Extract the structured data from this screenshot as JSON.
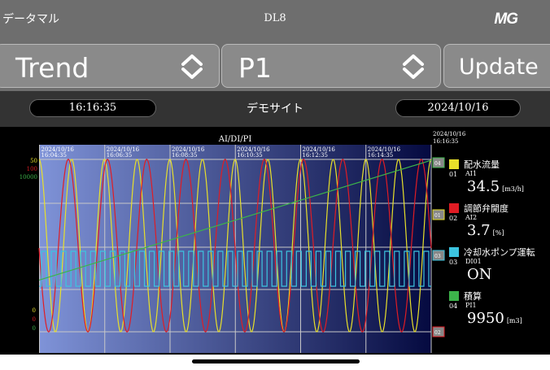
{
  "header": {
    "app_title": "データマル",
    "device_title": "DL8",
    "logo_text": "MG"
  },
  "controls": {
    "view_select": "Trend",
    "page_select": "P1",
    "update_label": "Update"
  },
  "info": {
    "time": "16:16:35",
    "site_name": "デモサイト",
    "date": "2024/10/16"
  },
  "colors": {
    "ai1": "#e8e02a",
    "ai2": "#e01c24",
    "di01": "#3cc4e0",
    "pi1": "#3cb44a",
    "plot_bg_left": "#7f93d8",
    "plot_bg_right": "#050a40"
  },
  "chart_data": {
    "type": "line",
    "title": "AI/DI/PI",
    "x_labels": [
      "2024/10/16 16:04:35",
      "2024/10/16 16:06:35",
      "2024/10/16 16:08:35",
      "2024/10/16 16:10:35",
      "2024/10/16 16:12:35",
      "2024/10/16 16:14:35"
    ],
    "x_end_label": "2024/10/16 16:16:35",
    "y_axis_top": [
      "50",
      "100",
      "10000"
    ],
    "y_axis_bottom": [
      "0",
      "0",
      "0"
    ],
    "grid": true,
    "series": [
      {
        "num": "01",
        "name": "配水流量",
        "tag": "AI1",
        "value": "34.5",
        "unit": "[m3/h]",
        "ylim": [
          0,
          50
        ],
        "kind": "sine",
        "amplitude": 25,
        "offset": 25,
        "period_min": 1.0,
        "phase": 0.0
      },
      {
        "num": "02",
        "name": "調節弁開度",
        "tag": "AI2",
        "value": "3.7",
        "unit": "[%]",
        "ylim": [
          0,
          100
        ],
        "kind": "sine",
        "amplitude": 50,
        "offset": 50,
        "period_min": 1.2,
        "phase": 1.6
      },
      {
        "num": "03",
        "name": "冷却水ポンプ運転",
        "tag": "DI01",
        "value": "ON",
        "unit": "",
        "kind": "square",
        "period_min": 0.3
      },
      {
        "num": "04",
        "name": "積算",
        "tag": "PI1",
        "value": "9950",
        "unit": "[m3]",
        "ylim": [
          0,
          10000
        ],
        "kind": "ramp",
        "start": 3000,
        "end": 9950
      }
    ],
    "end_markers": [
      "04",
      "01",
      "03",
      "02"
    ]
  }
}
